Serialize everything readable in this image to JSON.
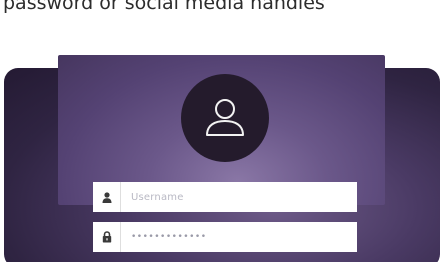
{
  "caption": {
    "text": "password or social media handles"
  },
  "login_form": {
    "avatar_icon": "user-outline-icon",
    "username": {
      "icon": "user-icon",
      "placeholder": "Username"
    },
    "password": {
      "icon": "lock-icon",
      "value": "•••••••••••••"
    }
  },
  "colors": {
    "frame_dark": "#2f2442",
    "panel_purple": "#6b588a",
    "avatar_circle": "#241b2c",
    "caption_text": "#2d2d2d",
    "field_bg": "#ffffff"
  }
}
